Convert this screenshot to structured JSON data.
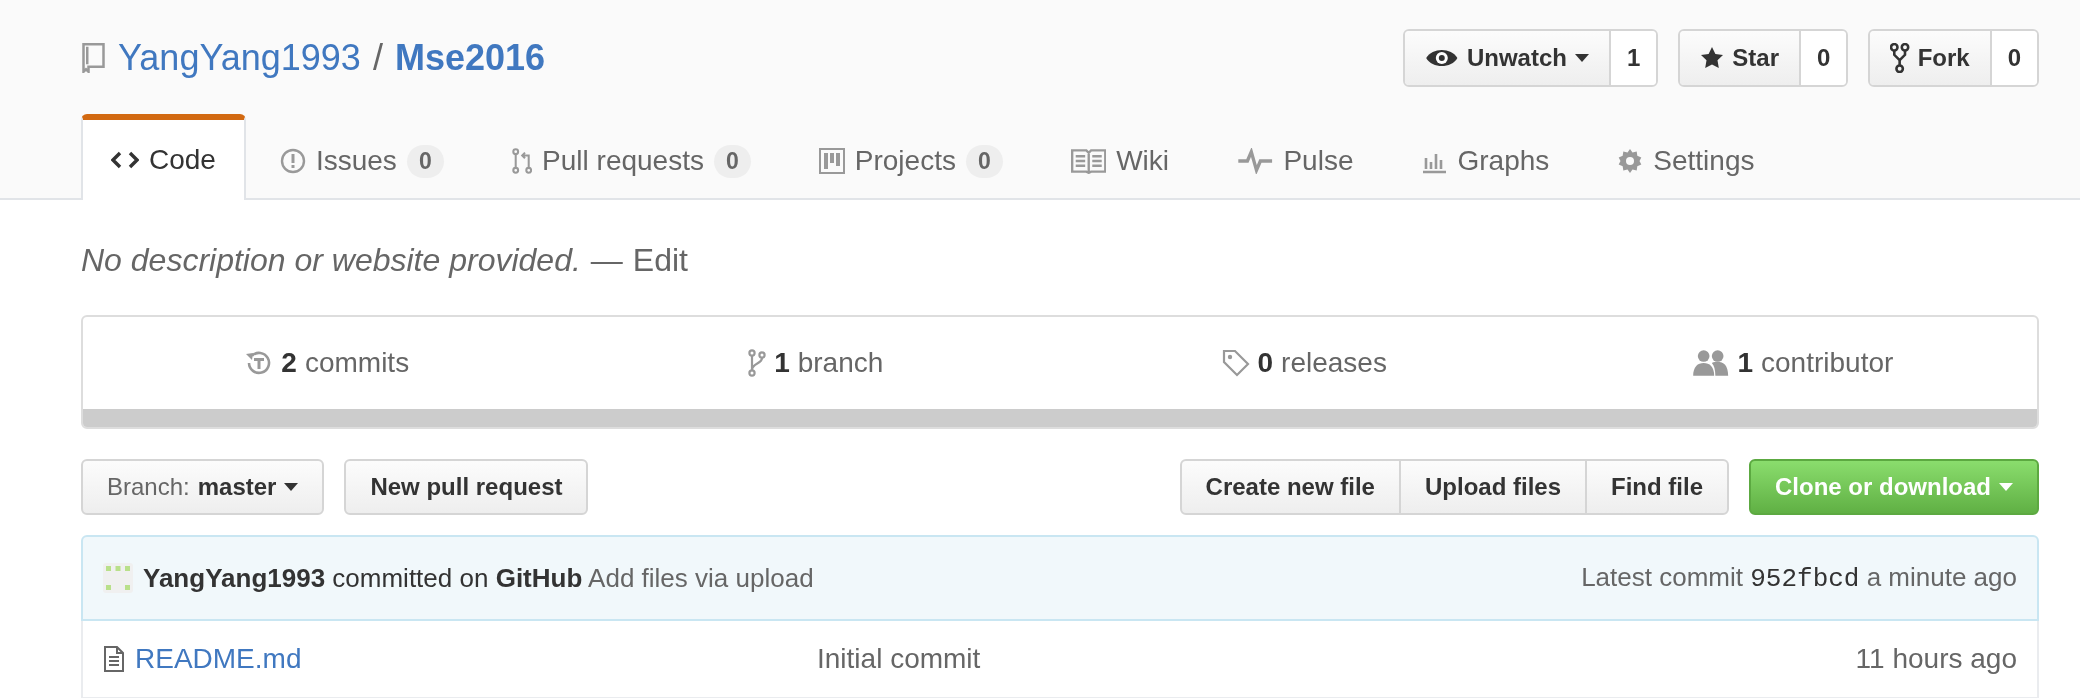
{
  "repo": {
    "owner": "YangYang1993",
    "separator": "/",
    "name": "Mse2016"
  },
  "actions": [
    {
      "kind": "watch",
      "label": "Unwatch",
      "count": "1"
    },
    {
      "kind": "star",
      "label": "Star",
      "count": "0"
    },
    {
      "kind": "fork",
      "label": "Fork",
      "count": "0"
    }
  ],
  "tabs": [
    {
      "kind": "code",
      "label": "Code",
      "selected": true
    },
    {
      "kind": "issue",
      "label": "Issues",
      "counter": "0",
      "selected": false
    },
    {
      "kind": "pull",
      "label": "Pull requests",
      "counter": "0",
      "selected": false
    },
    {
      "kind": "project",
      "label": "Projects",
      "counter": "0",
      "selected": false
    },
    {
      "kind": "wiki",
      "label": "Wiki",
      "selected": false
    },
    {
      "kind": "pulse",
      "label": "Pulse",
      "selected": false
    },
    {
      "kind": "graph",
      "label": "Graphs",
      "selected": false
    },
    {
      "kind": "gear",
      "label": "Settings",
      "selected": false
    }
  ],
  "description": {
    "text": "No description or website provided.",
    "separator": "—",
    "edit": "Edit"
  },
  "stats": [
    {
      "kind": "history",
      "count": "2",
      "label": "commits"
    },
    {
      "kind": "branch",
      "count": "1",
      "label": "branch"
    },
    {
      "kind": "tag",
      "count": "0",
      "label": "releases"
    },
    {
      "kind": "people",
      "count": "1",
      "label": "contributor"
    }
  ],
  "branch_select": {
    "label": "Branch:",
    "value": "master"
  },
  "new_pull_request": "New pull request",
  "file_buttons": [
    "Create new file",
    "Upload files",
    "Find file"
  ],
  "clone": "Clone or download",
  "commit": {
    "author": "YangYang1993",
    "verb": "committed on",
    "platform": "GitHub",
    "message": "Add files via upload",
    "latest_label": "Latest commit",
    "sha": "952fbcd",
    "time": "a minute ago"
  },
  "files": [
    {
      "kind": "file",
      "name": "README.md",
      "message": "Initial commit",
      "age": "11 hours ago"
    }
  ]
}
